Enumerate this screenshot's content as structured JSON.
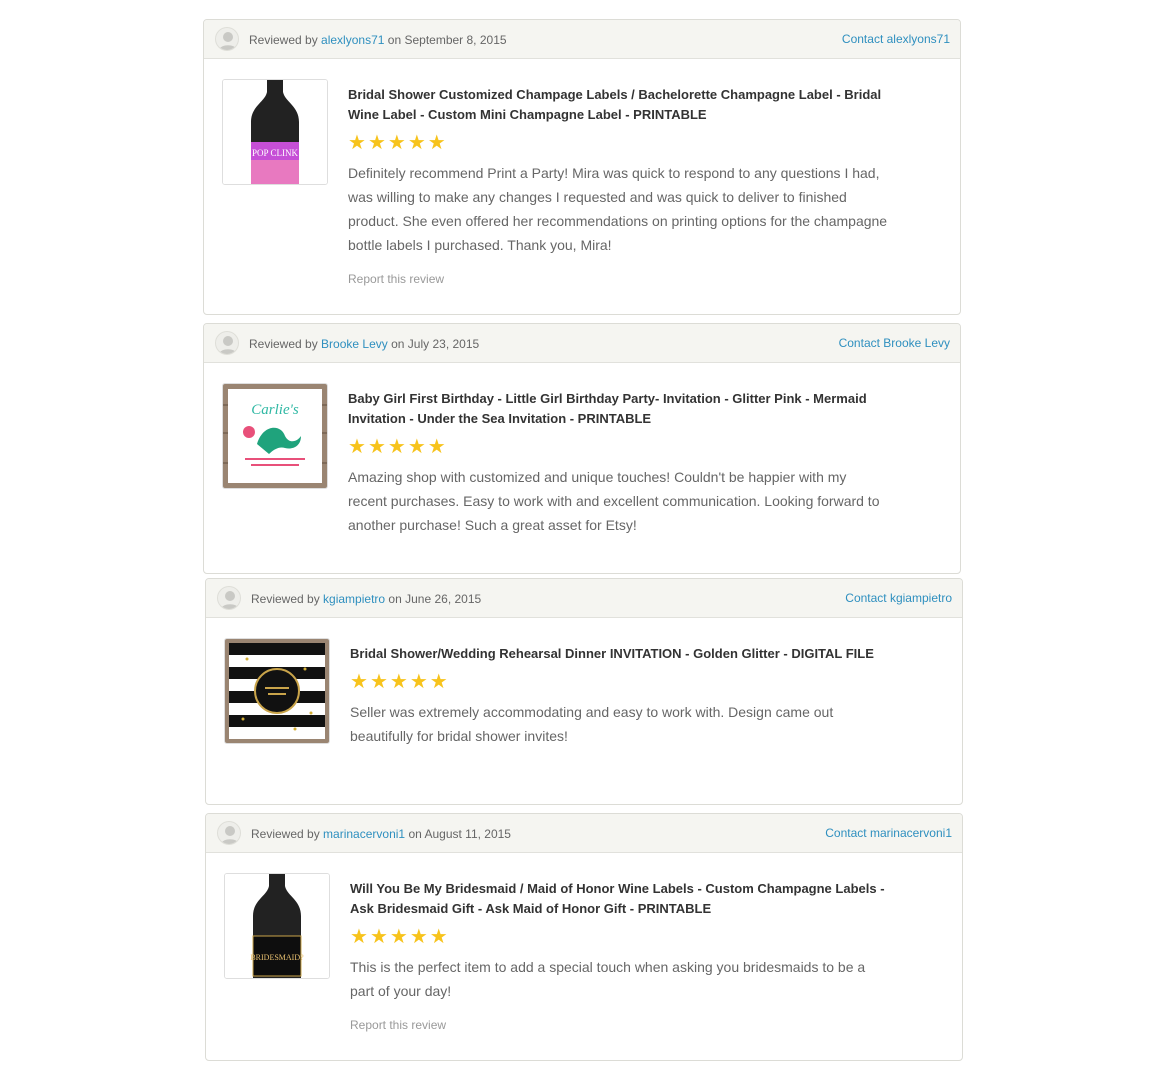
{
  "colors": {
    "link": "#2e8fbf",
    "star": "#f7c31c",
    "header_bg": "#f5f5f1"
  },
  "icons": {
    "avatar": "user-silhouette-icon",
    "star": "star-icon"
  },
  "reviews": [
    {
      "reviewed_by_prefix": "Reviewed by",
      "reviewer": "alexlyons71",
      "date_prefix": "on",
      "date": "September 8, 2015",
      "contact_label": "Contact alexlyons71",
      "product_title": "Bridal Shower Customized Champage Labels / Bachelorette Champagne Label - Bridal Wine Label - Custom Mini Champagne Label - PRINTABLE",
      "rating": 5,
      "text": "Definitely recommend Print a Party! Mira was quick to respond to any questions I had, was willing to make any changes I requested and was quick to deliver to finished product. She even offered her recommendations on printing options for the champagne bottle labels I purchased. Thank you, Mira!",
      "report_label": "Report this review",
      "thumb_label": "POP CLINK",
      "thumb_kind": "bottle-pink"
    },
    {
      "reviewed_by_prefix": "Reviewed by",
      "reviewer": "Brooke Levy",
      "date_prefix": "on",
      "date": "July 23, 2015",
      "contact_label": "Contact Brooke Levy",
      "product_title": "Baby Girl First Birthday - Little Girl Birthday Party- Invitation - Glitter Pink - Mermaid Invitation - Under the Sea Invitation - PRINTABLE",
      "rating": 5,
      "text": "Amazing shop with customized and unique touches! Couldn't be happier with my recent purchases. Easy to work with and excellent communication. Looking forward to another purchase! Such a great asset for Etsy!",
      "report_label": "",
      "thumb_label": "Carlie's",
      "thumb_kind": "mermaid-invite"
    },
    {
      "reviewed_by_prefix": "Reviewed by",
      "reviewer": "kgiampietro",
      "date_prefix": "on",
      "date": "June 26, 2015",
      "contact_label": "Contact kgiampietro",
      "product_title": "Bridal Shower/Wedding Rehearsal Dinner INVITATION - Golden Glitter - DIGITAL FILE",
      "rating": 5,
      "text": "Seller was extremely accommodating and easy to work with. Design came out beautifully for bridal shower invites!",
      "report_label": "",
      "thumb_label": "",
      "thumb_kind": "striped-invite"
    },
    {
      "reviewed_by_prefix": "Reviewed by",
      "reviewer": "marinacervoni1",
      "date_prefix": "on",
      "date": "August 11, 2015",
      "contact_label": "Contact marinacervoni1",
      "product_title": "Will You Be My Bridesmaid / Maid of Honor Wine Labels - Custom Champagne Labels - Ask Bridesmaid Gift - Ask Maid of Honor Gift - PRINTABLE",
      "rating": 5,
      "text": "This is the perfect item to add a special touch when asking you bridesmaids to be a part of your day!",
      "report_label": "Report this review",
      "thumb_label": "BRIDESMAID?",
      "thumb_kind": "bottle-black"
    }
  ]
}
